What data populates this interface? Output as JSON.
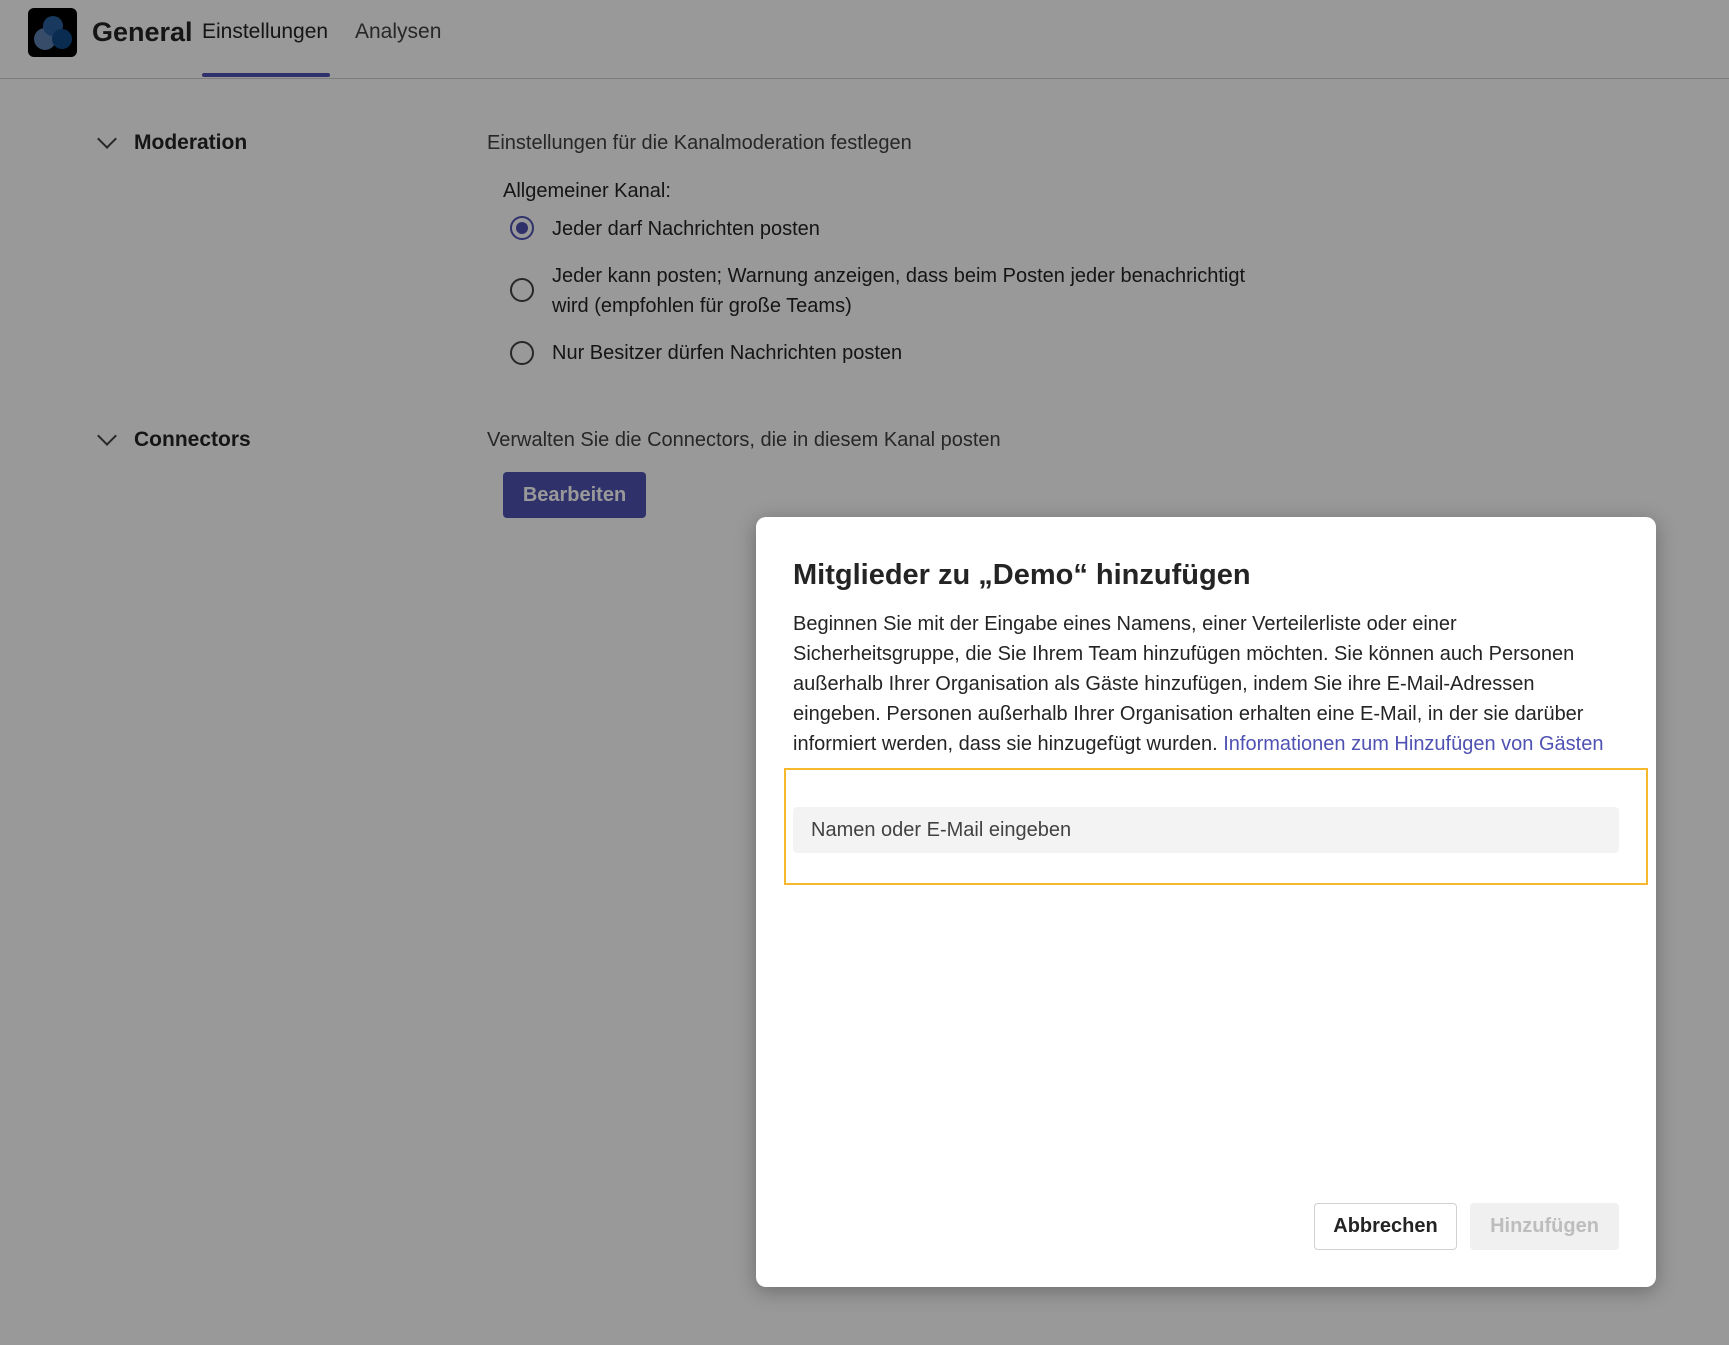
{
  "header": {
    "title": "General",
    "tabs": [
      {
        "label": "Einstellungen",
        "active": true
      },
      {
        "label": "Analysen",
        "active": false
      }
    ]
  },
  "moderation": {
    "heading": "Moderation",
    "description": "Einstellungen für die Kanalmoderation festlegen",
    "group_label": "Allgemeiner Kanal:",
    "options": [
      {
        "label": "Jeder darf Nachrichten posten",
        "selected": true
      },
      {
        "label_line1": "Jeder kann posten; Warnung anzeigen, dass beim Posten jeder benachrichtigt",
        "label_line2": "wird (empfohlen für große Teams)",
        "selected": false
      },
      {
        "label": "Nur Besitzer dürfen Nachrichten posten",
        "selected": false
      }
    ]
  },
  "connectors": {
    "heading": "Connectors",
    "description": "Verwalten Sie die Connectors, die in diesem Kanal posten",
    "edit_label": "Bearbeiten"
  },
  "dialog": {
    "title": "Mitglieder zu „Demo“ hinzufügen",
    "body": "Beginnen Sie mit der Eingabe eines Namens, einer Verteilerliste oder einer Sicherheitsgruppe, die Sie Ihrem Team hinzufügen möchten. Sie können auch Personen außerhalb Ihrer Organisation als Gäste hinzufügen, indem Sie ihre E-Mail-Adressen eingeben. Personen außerhalb Ihrer Organisation erhalten eine E-Mail, in der sie darüber informiert werden, dass sie hinzugefügt wurden.",
    "link": "Informationen zum Hinzufügen von Gästen",
    "input_placeholder": "Namen oder E-Mail eingeben",
    "input_value": "",
    "cancel_label": "Abbrechen",
    "add_label": "Hinzufügen"
  },
  "colors": {
    "accent": "#4f52b2",
    "focus": "#f5b82e"
  }
}
